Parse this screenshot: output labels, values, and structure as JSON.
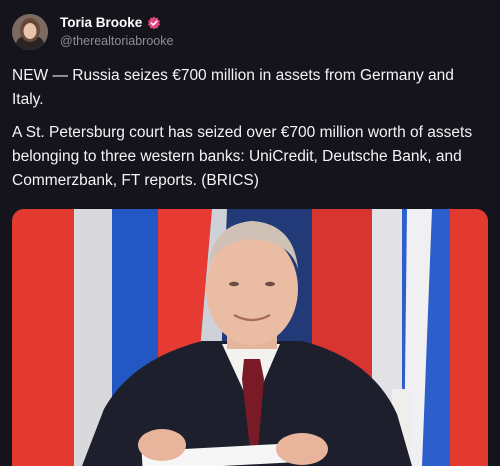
{
  "author": {
    "display_name": "Toria Brooke",
    "handle": "@therealtoriabrooke",
    "verified_icon": "verified-badge-icon",
    "badge_color": "#e0457b"
  },
  "post": {
    "paragraphs": [
      "NEW — Russia seizes €700 million in assets from Germany and Italy.",
      "A St. Petersburg court has seized over €700 million worth of assets belonging to three western banks: UniCredit, Deutsche Bank, and Commerzbank, FT reports. (BRICS)"
    ]
  },
  "media": {
    "image_icon": "photo-icon"
  },
  "colors": {
    "background": "#15141c",
    "text": "#f4f4f7",
    "secondary_text": "#8d8c99"
  }
}
